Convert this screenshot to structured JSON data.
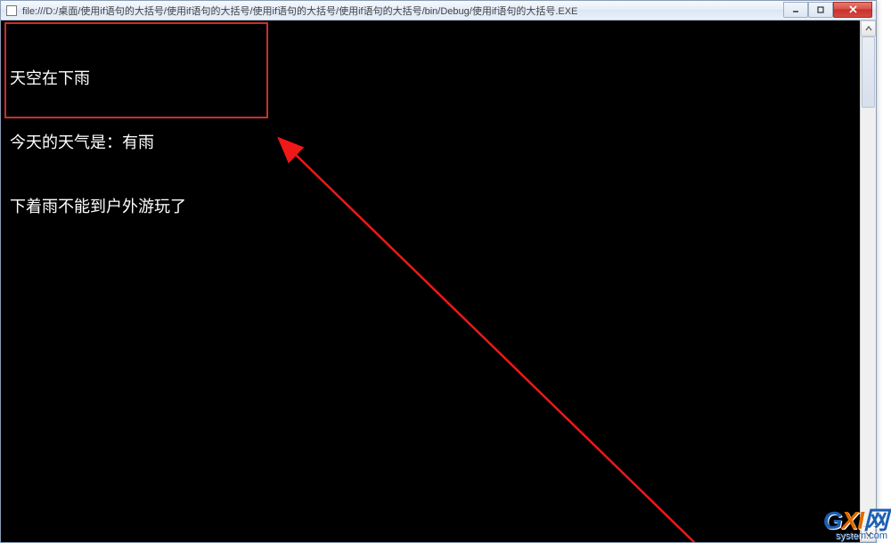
{
  "titlebar": {
    "text": "file:///D:/桌面/使用if语句的大括号/使用if语句的大括号/使用if语句的大括号/使用if语句的大括号/bin/Debug/使用if语句的大括号.EXE"
  },
  "console": {
    "lines": [
      "天空在下雨",
      "今天的天气是：有雨",
      "下着雨不能到户外游玩了"
    ]
  },
  "annotation": {
    "highlight_color": "#c8302a",
    "arrow_color": "#f01818"
  },
  "watermark": {
    "brand_prefix": "G",
    "brand_accent": "XI",
    "brand_suffix": "网",
    "sub": "system.com"
  }
}
